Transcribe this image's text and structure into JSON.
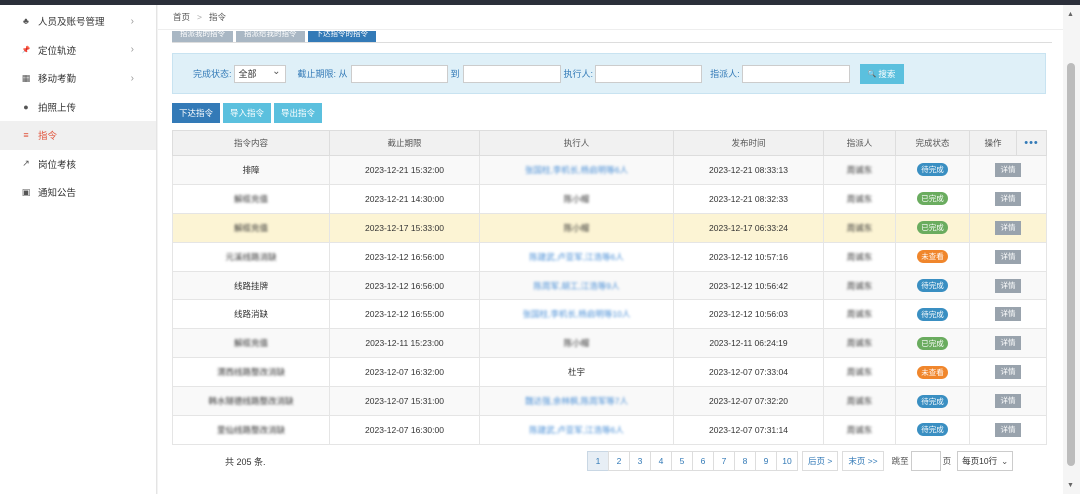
{
  "sidebar": {
    "items": [
      {
        "label": "人员及账号管理",
        "icon": "sitemap-icon",
        "chevron": "›"
      },
      {
        "label": "定位轨迹",
        "icon": "pin-icon",
        "chevron": "›"
      },
      {
        "label": "移动考勤",
        "icon": "calendar-icon",
        "chevron": "›"
      },
      {
        "label": "拍照上传",
        "icon": "user-icon",
        "chevron": ""
      },
      {
        "label": "指令",
        "icon": "list-icon",
        "chevron": "",
        "active": true
      },
      {
        "label": "岗位考核",
        "icon": "chart-icon",
        "chevron": ""
      },
      {
        "label": "通知公告",
        "icon": "notice-icon",
        "chevron": ""
      }
    ]
  },
  "breadcrumb": {
    "home": "首页",
    "sep": ">",
    "current": "指令"
  },
  "tabs": [
    "指派我的指令",
    "指派给我的指令",
    "下达指令的指令"
  ],
  "filter": {
    "status_label": "完成状态:",
    "status_value": "全部",
    "deadline_label": "截止期限: 从",
    "to_label": "到",
    "executor_label": "执行人:",
    "assigner_label": "指派人:",
    "search_label": "搜索",
    "search_icon": "🔍"
  },
  "actions": {
    "issue": "下达指令",
    "import": "导入指令",
    "export": "导出指令"
  },
  "table": {
    "headers": [
      "指令内容",
      "截止期限",
      "执行人",
      "发布时间",
      "指派人",
      "完成状态",
      "操作"
    ],
    "more": "•••",
    "detail_label": "详情",
    "rows": [
      {
        "content": "排障",
        "deadline": "2023-12-21 15:32:00",
        "executor": "张国柱,李机长,杨启明等6人",
        "exec_link": true,
        "published": "2023-12-21 08:33:13",
        "assigner": "周诚东",
        "status": "待完成",
        "status_color": "#3a8fc2"
      },
      {
        "content": "解缆充值",
        "deadline": "2023-12-21 14:30:00",
        "executor": "陈小帽",
        "exec_link": false,
        "published": "2023-12-21 08:32:33",
        "assigner": "周诚东",
        "status": "已完成",
        "status_color": "#6aac5f"
      },
      {
        "content": "解缆充值",
        "deadline": "2023-12-17 15:33:00",
        "executor": "陈小帽",
        "exec_link": false,
        "published": "2023-12-17 06:33:24",
        "assigner": "周诚东",
        "status": "已完成",
        "status_color": "#6aac5f"
      },
      {
        "content": "元溪线路消缺",
        "deadline": "2023-12-12 16:56:00",
        "executor": "陈建武,卢亚军,江浩等6人",
        "exec_link": true,
        "published": "2023-12-12 10:57:16",
        "assigner": "周诚东",
        "status": "未查看",
        "status_color": "#f0862c"
      },
      {
        "content": "线路挂牌",
        "deadline": "2023-12-12 16:56:00",
        "executor": "陈周军,胡工,江浩等9人",
        "exec_link": true,
        "published": "2023-12-12 10:56:42",
        "assigner": "周诚东",
        "status": "待完成",
        "status_color": "#3a8fc2"
      },
      {
        "content": "线路消缺",
        "deadline": "2023-12-12 16:55:00",
        "executor": "张国柱,李机长,杨启明等10人",
        "exec_link": true,
        "published": "2023-12-12 10:56:03",
        "assigner": "周诚东",
        "status": "待完成",
        "status_color": "#3a8fc2"
      },
      {
        "content": "解缆充值",
        "deadline": "2023-12-11 15:23:00",
        "executor": "陈小帽",
        "exec_link": false,
        "published": "2023-12-11 06:24:19",
        "assigner": "周诚东",
        "status": "已完成",
        "status_color": "#6aac5f"
      },
      {
        "content": "渭西线路整改消缺",
        "deadline": "2023-12-07 16:32:00",
        "executor": "杜宇",
        "exec_link": false,
        "published": "2023-12-07 07:33:04",
        "assigner": "周诚东",
        "status": "未查看",
        "status_color": "#f0862c"
      },
      {
        "content": "韩水隧德线路整改消缺",
        "deadline": "2023-12-07 15:31:00",
        "executor": "魏达强,余林枫,陈周军等7人",
        "exec_link": true,
        "published": "2023-12-07 07:32:20",
        "assigner": "周诚东",
        "status": "待完成",
        "status_color": "#3a8fc2"
      },
      {
        "content": "里仙线路整改消缺",
        "deadline": "2023-12-07 16:30:00",
        "executor": "陈建武,卢亚军,江浩等6人",
        "exec_link": true,
        "published": "2023-12-07 07:31:14",
        "assigner": "周诚东",
        "status": "待完成",
        "status_color": "#3a8fc2"
      }
    ]
  },
  "footer": {
    "total": "共 205 条.",
    "pages": [
      "1",
      "2",
      "3",
      "4",
      "5",
      "6",
      "7",
      "8",
      "9",
      "10"
    ],
    "current_page": "1",
    "next": "后页 >",
    "last": "末页 >>",
    "jump_label": "跳至",
    "page_suffix": "页",
    "per_page": "每页10行"
  }
}
